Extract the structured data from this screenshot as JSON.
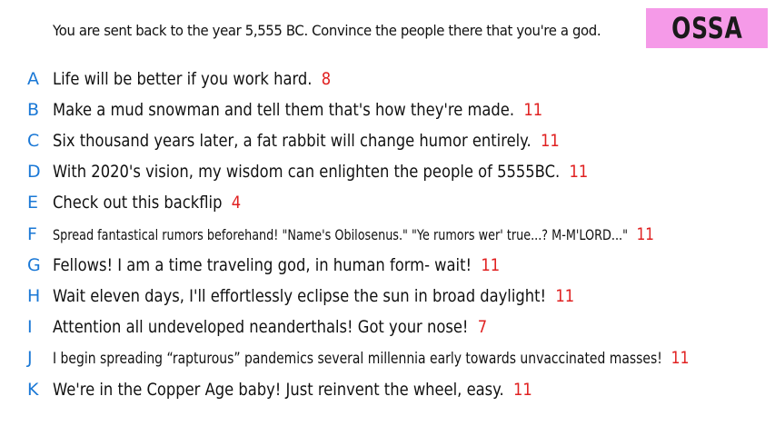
{
  "prompt": "You are sent back to the year 5,555 BC. Convince the people there that you're a god.",
  "logo": "OSSA",
  "colors": {
    "letter": "#1a78d6",
    "score": "#e02020",
    "logo_background": "#f59ae8"
  },
  "answers": [
    {
      "letter": "A",
      "text": "Life will be better if you work hard.",
      "score": "8"
    },
    {
      "letter": "B",
      "text": "Make a mud snowman and tell them that's how they're made.",
      "score": "11"
    },
    {
      "letter": "C",
      "text": "Six thousand years later, a fat rabbit will change humor entirely.",
      "score": "11"
    },
    {
      "letter": "D",
      "text": "With 2020's vision, my wisdom can enlighten the people of 5555BC.",
      "score": "11"
    },
    {
      "letter": "E",
      "text": "Check out this backflip",
      "score": "4"
    },
    {
      "letter": "F",
      "text": "Spread fantastical rumors beforehand! \"Name's Obilosenus.\" \"Ye rumors wer' true...? M-M'LORD...\"",
      "score": "11"
    },
    {
      "letter": "G",
      "text": "Fellows! I am a time traveling god, in human form- wait!",
      "score": "11"
    },
    {
      "letter": "H",
      "text": "Wait eleven days, I'll effortlessly eclipse the sun in broad daylight!",
      "score": "11"
    },
    {
      "letter": "I",
      "text": "Attention all undeveloped neanderthals! Got your nose!",
      "score": "7"
    },
    {
      "letter": "J",
      "text": "I begin spreading “rapturous” pandemics several millennia early towards unvaccinated masses!",
      "score": "11"
    },
    {
      "letter": "K",
      "text": "We're in the Copper Age baby! Just reinvent the wheel, easy.",
      "score": "11"
    }
  ]
}
